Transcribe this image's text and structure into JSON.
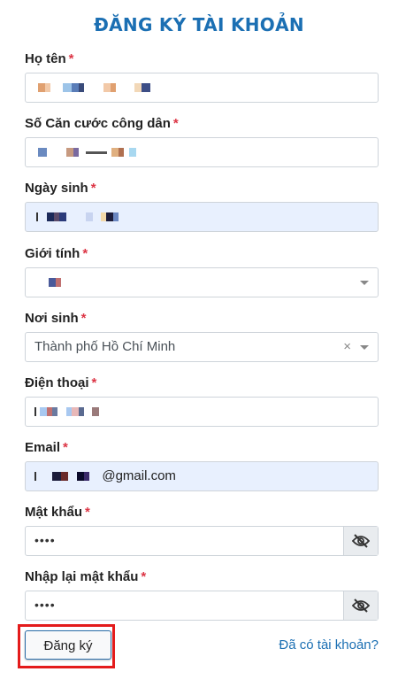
{
  "title": "ĐĂNG KÝ TÀI KHOẢN",
  "fields": {
    "fullname": {
      "label": "Họ tên",
      "required": "*"
    },
    "cccd": {
      "label": "Số Căn cước công dân",
      "required": "*"
    },
    "dob": {
      "label": "Ngày sinh",
      "required": "*"
    },
    "gender": {
      "label": "Giới tính",
      "required": "*"
    },
    "birthplace": {
      "label": "Nơi sinh",
      "required": "*",
      "value": "Thành phố Hồ Chí Minh",
      "clear": "×"
    },
    "phone": {
      "label": "Điện thoại",
      "required": "*"
    },
    "email": {
      "label": "Email",
      "required": "*",
      "value_suffix": "@gmail.com"
    },
    "password": {
      "label": "Mật khẩu",
      "required": "*",
      "value": "••••"
    },
    "password_confirm": {
      "label": "Nhập lại mật khẩu",
      "required": "*",
      "value": "••••"
    }
  },
  "actions": {
    "register_label": "Đăng ký",
    "login_link": "Đã có tài khoản?"
  },
  "colors": {
    "accent": "#1b6fb3",
    "required": "#dc3545",
    "autofill_bg": "#e8f0fe",
    "highlight_outline": "#e41b1b"
  },
  "icons": {
    "password_toggle": "eye-slash-icon",
    "dropdown": "chevron-down-icon"
  }
}
